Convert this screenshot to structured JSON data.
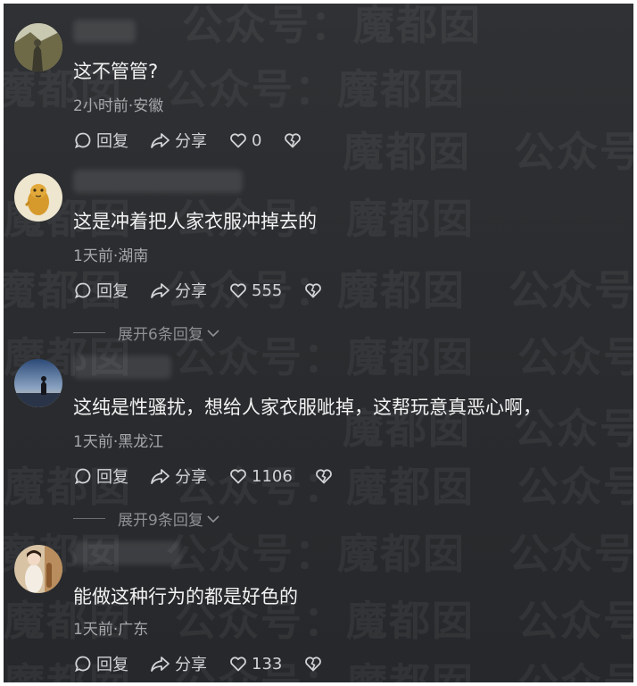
{
  "watermark": {
    "text": "魔都囡 公众号："
  },
  "comments": [
    {
      "text": "这不管管?",
      "meta": "2小时前·安徽",
      "reply_label": "回复",
      "share_label": "分享",
      "likes": "0"
    },
    {
      "text": "这是冲着把人家衣服冲掉去的",
      "meta": "1天前·湖南",
      "reply_label": "回复",
      "share_label": "分享",
      "likes": "555",
      "expand_label": "展开6条回复"
    },
    {
      "text": "这纯是性骚扰，想给人家衣服呲掉，这帮玩意真恶心啊，",
      "meta": "1天前·黑龙江",
      "reply_label": "回复",
      "share_label": "分享",
      "likes": "1106",
      "expand_label": "展开9条回复"
    },
    {
      "text": "能做这种行为的都是好色的",
      "meta": "1天前·广东",
      "reply_label": "回复",
      "share_label": "分享",
      "likes": "133"
    }
  ]
}
